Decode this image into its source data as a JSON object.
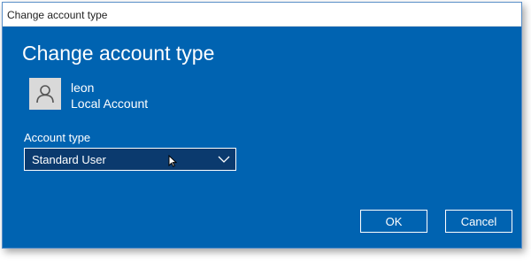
{
  "window": {
    "title": "Change account type"
  },
  "dialog": {
    "heading": "Change account type",
    "user": {
      "name": "leon",
      "account_kind": "Local Account",
      "avatar_icon": "user-avatar-icon"
    },
    "account_type": {
      "label": "Account type",
      "selected": "Standard User",
      "dropdown_icon": "chevron-down-icon"
    },
    "buttons": {
      "ok": "OK",
      "cancel": "Cancel"
    }
  },
  "colors": {
    "dialog_background": "#0063b1",
    "dropdown_background": "#0b3a6e",
    "text": "#ffffff",
    "avatar_background": "#d9d9d9"
  }
}
